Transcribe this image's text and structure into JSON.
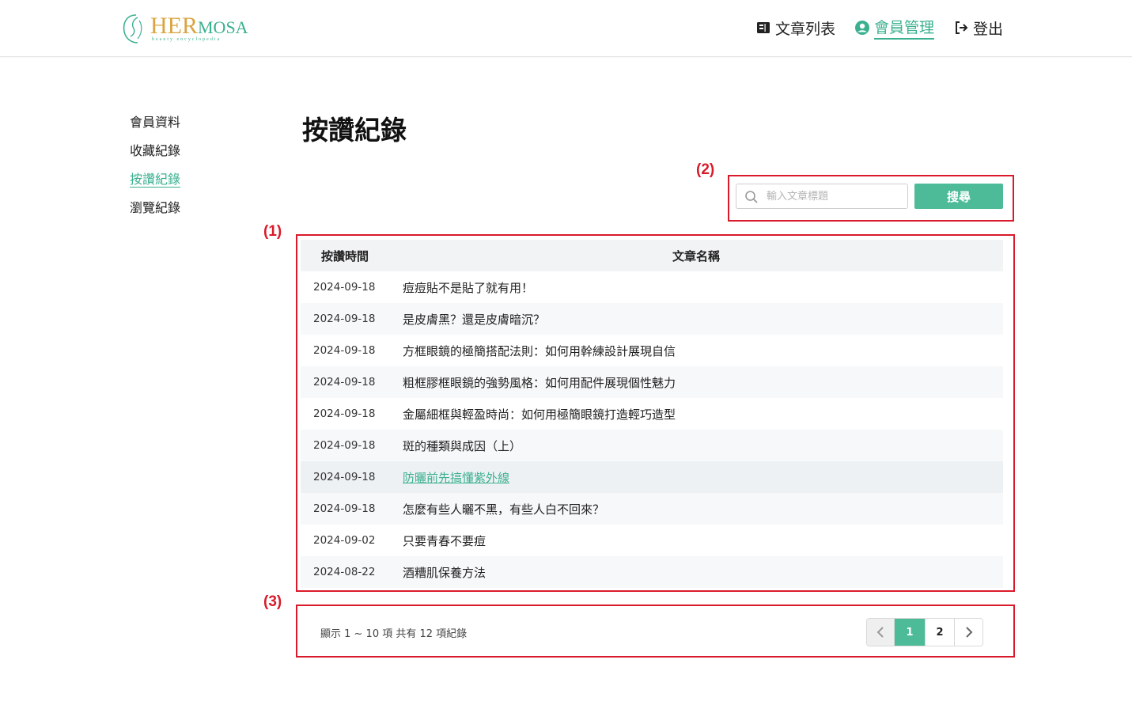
{
  "header": {
    "logo_text_main": "HER",
    "logo_text_rest": "MOSA",
    "logo_subtitle": "beauty encyclopedia",
    "nav": [
      {
        "label": "文章列表",
        "icon": "book-icon"
      },
      {
        "label": "會員管理",
        "icon": "user-circle-icon"
      },
      {
        "label": "登出",
        "icon": "logout-icon"
      }
    ],
    "active_nav": "會員管理"
  },
  "sidebar": {
    "items": [
      {
        "label": "會員資料"
      },
      {
        "label": "收藏紀錄"
      },
      {
        "label": "按讚紀錄"
      },
      {
        "label": "瀏覽紀錄"
      }
    ],
    "active": "按讚紀錄"
  },
  "page_title": "按讚紀錄",
  "search": {
    "placeholder": "輸入文章標題",
    "value": "",
    "button_label": "搜尋"
  },
  "annotations": {
    "table": "(1)",
    "search": "(2)",
    "pager": "(3)"
  },
  "table": {
    "columns": [
      "按讚時間",
      "文章名稱"
    ],
    "rows": [
      {
        "date": "2024-09-18",
        "title": "痘痘貼不是貼了就有用！"
      },
      {
        "date": "2024-09-18",
        "title": "是皮膚黑？還是皮膚暗沉？"
      },
      {
        "date": "2024-09-18",
        "title": "方框眼鏡的極簡搭配法則：如何用幹練設計展現自信"
      },
      {
        "date": "2024-09-18",
        "title": "粗框膠框眼鏡的強勢風格：如何用配件展現個性魅力"
      },
      {
        "date": "2024-09-18",
        "title": "金屬細框與輕盈時尚：如何用極簡眼鏡打造輕巧造型"
      },
      {
        "date": "2024-09-18",
        "title": "斑的種類與成因（上）"
      },
      {
        "date": "2024-09-18",
        "title": "防曬前先搞懂紫外線"
      },
      {
        "date": "2024-09-18",
        "title": "怎麼有些人曬不黑，有些人白不回來？"
      },
      {
        "date": "2024-09-02",
        "title": "只要青春不要痘"
      },
      {
        "date": "2024-08-22",
        "title": "酒糟肌保養方法"
      }
    ],
    "hovered_row": 6
  },
  "pagination": {
    "info": "顯示 1 ~ 10 項 共有 12 項紀錄",
    "pages": [
      "1",
      "2"
    ],
    "current": "1"
  },
  "colors": {
    "accent": "#4dbb98",
    "annotation": "#d91a2a",
    "logo_gold": "#d9a441"
  }
}
